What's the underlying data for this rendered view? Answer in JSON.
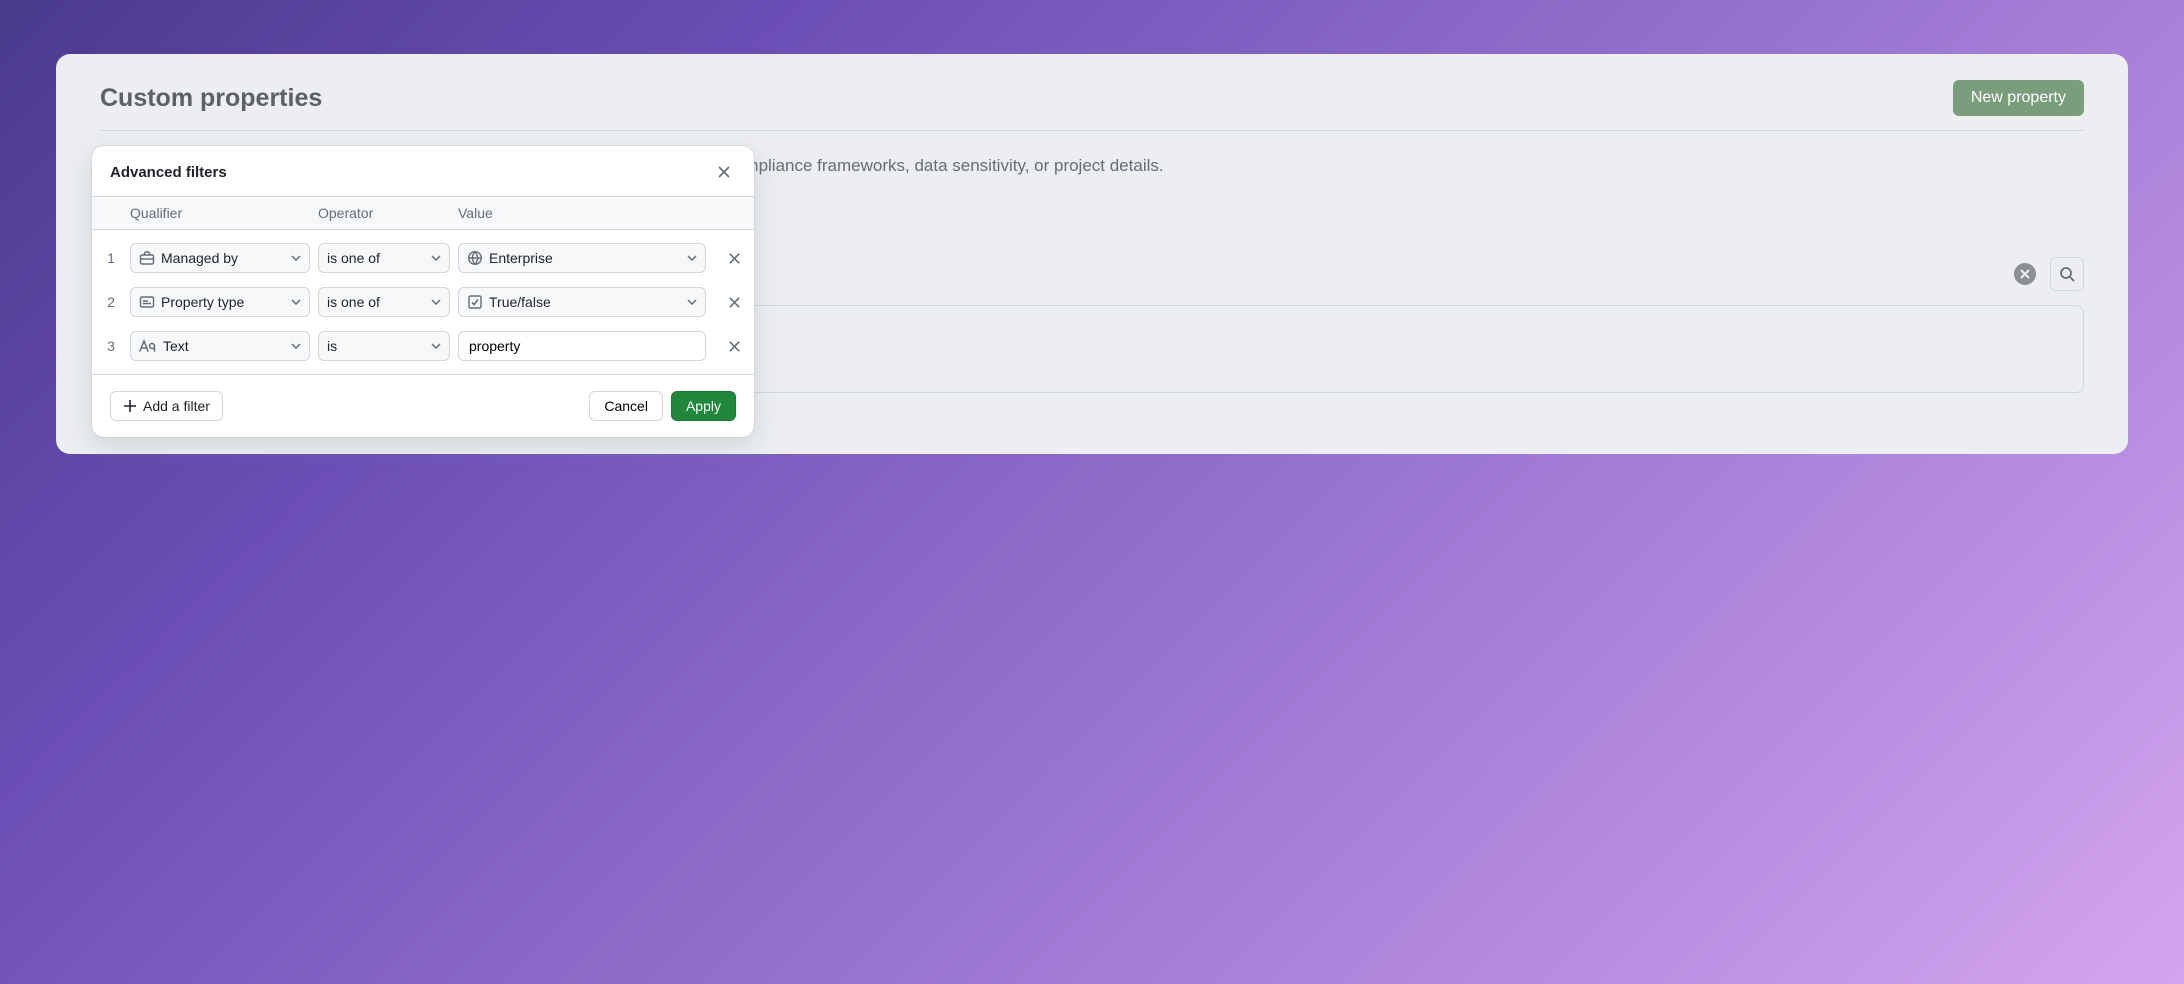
{
  "page": {
    "title": "Custom properties",
    "new_button": "New property",
    "description": "Custom properties allow you to decorate your repositories with information such as compliance frameworks, data sensitivity, or project details."
  },
  "dialog": {
    "title": "Advanced filters",
    "columns": {
      "qualifier": "Qualifier",
      "operator": "Operator",
      "value": "Value"
    },
    "filters": [
      {
        "num": "1",
        "qualifier_icon": "briefcase-icon",
        "qualifier": "Managed by",
        "operator": "is one of",
        "value_icon": "globe-icon",
        "value": "Enterprise",
        "value_type": "select"
      },
      {
        "num": "2",
        "qualifier_icon": "card-icon",
        "qualifier": "Property type",
        "operator": "is one of",
        "value_icon": "checkbox-icon",
        "value": "True/false",
        "value_type": "select"
      },
      {
        "num": "3",
        "qualifier_icon": "text-aa-icon",
        "qualifier": "Text",
        "operator": "is",
        "value": "property",
        "value_type": "text"
      }
    ],
    "add_filter": "Add a filter",
    "cancel": "Cancel",
    "apply": "Apply"
  }
}
